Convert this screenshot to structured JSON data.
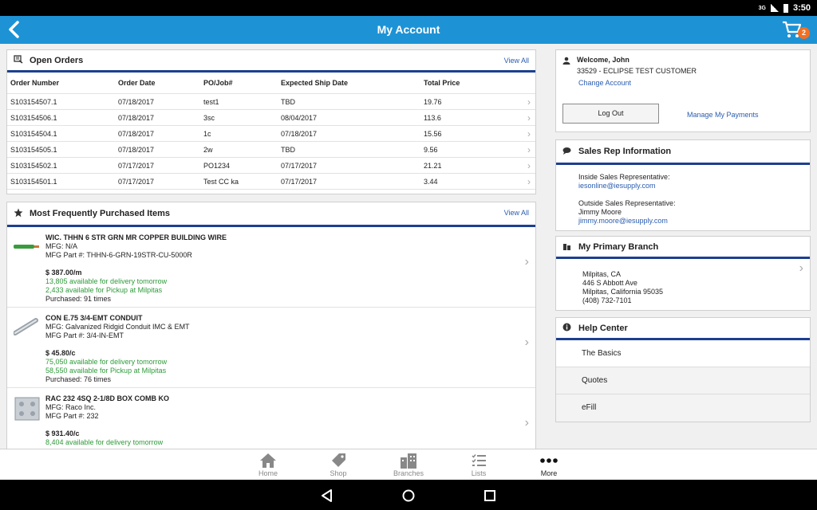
{
  "status": {
    "network": "3G",
    "time": "3:50"
  },
  "header": {
    "title": "My Account",
    "cart_count": "2"
  },
  "open_orders": {
    "title": "Open Orders",
    "view_all": "View All",
    "columns": [
      "Order Number",
      "Order Date",
      "PO/Job#",
      "Expected Ship Date",
      "Total Price"
    ],
    "rows": [
      [
        "S103154507.1",
        "07/18/2017",
        "test1",
        "TBD",
        "19.76"
      ],
      [
        "S103154506.1",
        "07/18/2017",
        "3sc",
        "08/04/2017",
        "113.6"
      ],
      [
        "S103154504.1",
        "07/18/2017",
        "1c",
        "07/18/2017",
        "15.56"
      ],
      [
        "S103154505.1",
        "07/18/2017",
        "2w",
        "TBD",
        "9.56"
      ],
      [
        "S103154502.1",
        "07/17/2017",
        "PO1234",
        "07/17/2017",
        "21.21"
      ],
      [
        "S103154501.1",
        "07/17/2017",
        "Test CC ka",
        "07/17/2017",
        "3.44"
      ]
    ]
  },
  "frequent_items": {
    "title": "Most Frequently Purchased Items",
    "view_all": "View All",
    "items": [
      {
        "name": "WIC. THHN 6 STR GRN MR COPPER BUILDING WIRE",
        "mfg": "MFG: N/A",
        "part": "MFG Part #: THHN-6-GRN-19STR-CU-5000R",
        "price": "$ 387.00/m",
        "delivery": "13,805 available for delivery tomorrow",
        "pickup": "2,433 available for Pickup at Milpitas",
        "purchased": "Purchased: 91 times"
      },
      {
        "name": "CON E.75 3/4-EMT CONDUIT",
        "mfg": "MFG: Galvanized Ridgid Conduit IMC & EMT",
        "part": "MFG Part #: 3/4-IN-EMT",
        "price": "$ 45.80/c",
        "delivery": "75,050 available for delivery tomorrow",
        "pickup": "58,550 available for Pickup at Milpitas",
        "purchased": "Purchased: 76 times"
      },
      {
        "name": "RAC 232 4SQ 2-1/8D BOX COMB KO",
        "mfg": "MFG: Raco Inc.",
        "part": "MFG Part #: 232",
        "price": "$ 931.40/c",
        "delivery": "8,404 available for delivery tomorrow",
        "pickup": "",
        "purchased": ""
      }
    ]
  },
  "account": {
    "welcome": "Welcome, John",
    "account_line": "33529  -  ECLIPSE TEST CUSTOMER",
    "change_account": "Change Account",
    "logout": "Log Out",
    "manage_payments": "Manage My Payments"
  },
  "sales_rep": {
    "title": "Sales Rep Information",
    "inside_label": "Inside Sales Representative:",
    "inside_email": "iesonline@iesupply.com",
    "outside_label": "Outside Sales Representative:",
    "outside_name": "Jimmy Moore",
    "outside_email": "jimmy.moore@iesupply.com"
  },
  "branch": {
    "title": "My Primary Branch",
    "city": "Milpitas, CA",
    "street": "446 S Abbott Ave",
    "city_state_zip": "Milpitas, California 95035",
    "phone": "(408) 732-7101"
  },
  "help": {
    "title": "Help Center",
    "items": [
      "The Basics",
      "Quotes",
      "eFill"
    ]
  },
  "tabs": [
    "Home",
    "Shop",
    "Branches",
    "Lists",
    "More"
  ],
  "colors": {
    "primary": "#1d93d6",
    "accent": "#f36f21",
    "link": "#2a5db0",
    "available": "#2e9b3a",
    "rule": "#1d3f8f"
  }
}
